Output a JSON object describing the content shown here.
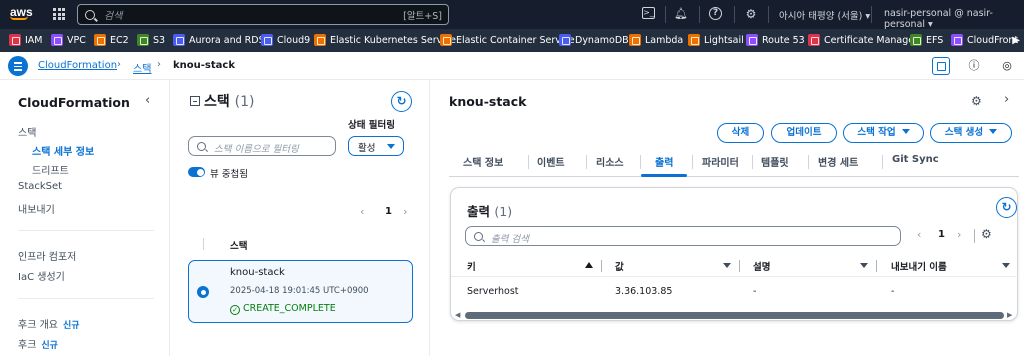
{
  "topbar": {
    "logo": "aws",
    "search_placeholder": "검색",
    "search_shortcut": "[알트+S]",
    "region": "아시아 태평양 (서울)",
    "account": "nasir-personal @ nasir-personal"
  },
  "favorites": [
    {
      "label": "IAM",
      "color": "#dd344c"
    },
    {
      "label": "VPC",
      "color": "#8c4fff"
    },
    {
      "label": "EC2",
      "color": "#ed7100"
    },
    {
      "label": "S3",
      "color": "#3f8624"
    },
    {
      "label": "Aurora and RDS",
      "color": "#4b5cf0"
    },
    {
      "label": "Cloud9",
      "color": "#4b5cf0"
    },
    {
      "label": "Elastic Kubernetes Service",
      "color": "#ed7100"
    },
    {
      "label": "Elastic Container Service",
      "color": "#ed7100"
    },
    {
      "label": "DynamoDB",
      "color": "#4b5cf0"
    },
    {
      "label": "Lambda",
      "color": "#ed7100"
    },
    {
      "label": "Lightsail",
      "color": "#ed7100"
    },
    {
      "label": "Route 53",
      "color": "#8c4fff"
    },
    {
      "label": "Certificate Manager",
      "color": "#dd344c"
    },
    {
      "label": "EFS",
      "color": "#3f8624"
    },
    {
      "label": "CloudFront",
      "color": "#8c4fff"
    }
  ],
  "breadcrumb": {
    "root": "CloudFormation",
    "mid": "스택",
    "current": "knou-stack"
  },
  "nav": {
    "title": "CloudFormation",
    "stacks": "스택",
    "stack_detail": "스택 세부 정보",
    "drift": "드리프트",
    "stackset": "StackSet",
    "exports": "내보내기",
    "infra_composer": "인프라 컴포저",
    "iac_generator": "IaC 생성기",
    "hooks_overview": "후크 개요",
    "hooks": "후크",
    "new_badge": "신규"
  },
  "stacks_panel": {
    "title": "스택",
    "count": "(1)",
    "filter_placeholder": "스택 이름으로 필터링",
    "status_filter_label": "상태 필터링",
    "status_filter_value": "활성",
    "nested_view_label": "뷰 중첩됨",
    "page": "1",
    "column_header": "스택",
    "stack": {
      "name": "knou-stack",
      "created": "2025-04-18 19:01:45 UTC+0900",
      "status": "CREATE_COMPLETE"
    }
  },
  "detail": {
    "title": "knou-stack",
    "buttons": {
      "delete": "삭제",
      "update": "업데이트",
      "stack_actions": "스택 작업",
      "create_stack": "스택 생성"
    },
    "tabs": [
      "스택 정보",
      "이벤트",
      "리소스",
      "출력",
      "파라미터",
      "템플릿",
      "변경 세트",
      "Git Sync"
    ],
    "active_tab": "출력",
    "outputs": {
      "title": "출력",
      "count": "(1)",
      "search_placeholder": "출력 검색",
      "page": "1",
      "columns": [
        "키",
        "값",
        "설명",
        "내보내기 이름"
      ],
      "rows": [
        {
          "key": "Serverhost",
          "value": "3.36.103.85",
          "description": "-",
          "export_name": "-"
        }
      ]
    }
  },
  "colors": {
    "accent": "#0972d3",
    "success": "#037f0c",
    "topbar": "#161e2d",
    "favbar": "#232f3e"
  }
}
